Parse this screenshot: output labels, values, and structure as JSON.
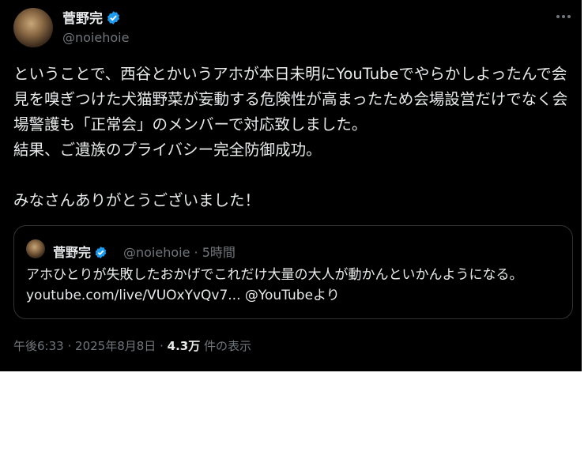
{
  "author": {
    "display_name": "菅野完",
    "handle": "@noiehoie"
  },
  "icons": [
    "verified-badge-icon",
    "more-icon",
    "avatar"
  ],
  "colors": {
    "verified": "#1d9bf0",
    "background": "#000000",
    "text": "#e7e9ea",
    "muted": "#71767b"
  },
  "tweet": {
    "text": "ということで、西谷とかいうアホが本日未明にYouTubeでやらかしよったんで会見を嗅ぎつけた犬猫野菜が妄動する危険性が高まったため会場設営だけでなく会場警護も「正常会」のメンバーで対応致しました。\n結果、ご遺族のプライバシー完全防御成功。\n\nみなさんありがとうございました！"
  },
  "quote": {
    "display_name": "菅野完",
    "handle": "@noiehoie",
    "separator": "·",
    "time": "5時間",
    "text_before": "アホひとりが失敗したおかげでこれだけ大量の大人が動かんといかんようになる。 ",
    "link": "youtube.com/live/VUOxYvQv7...",
    "text_after": " @YouTubeより"
  },
  "footer": {
    "time": "午後6:33",
    "date": "2025年8月8日",
    "separator": "·",
    "views_count": "4.3万",
    "views_label": "件の表示"
  }
}
